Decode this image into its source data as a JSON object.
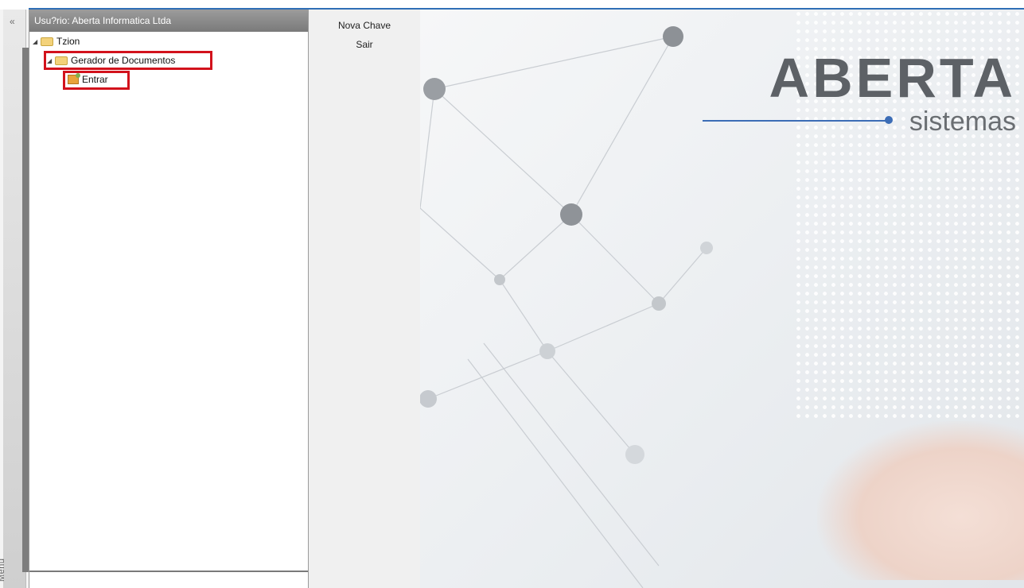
{
  "menu": {
    "label": "Menu",
    "collapse_glyph": "«"
  },
  "tree": {
    "header": "Usu?rio: Aberta Informatica Ltda",
    "nodes": [
      {
        "label": "Tzion",
        "icon": "folder-icon"
      },
      {
        "label": "Gerador de Documentos",
        "icon": "folder-icon"
      },
      {
        "label": "Entrar",
        "icon": "program-icon"
      }
    ]
  },
  "actions": [
    {
      "label": "Nova Chave"
    },
    {
      "label": "Sair"
    }
  ],
  "splash": {
    "logo_text": "ABERTA",
    "logo_sub": "sistemas",
    "accent_color": "#3c6db6"
  },
  "highlight_color": "#d2121c"
}
